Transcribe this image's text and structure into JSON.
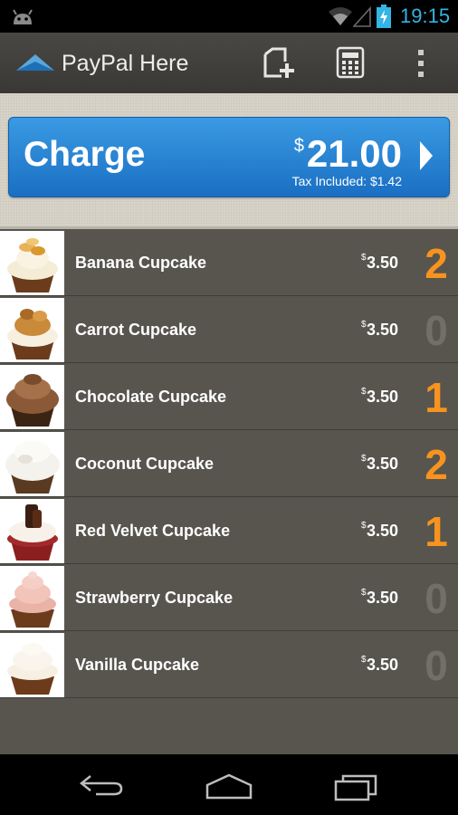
{
  "status_bar": {
    "time": "19:15"
  },
  "action_bar": {
    "title": "PayPal Here",
    "actions": [
      "new-item-icon",
      "calculator-icon",
      "overflow-menu-icon"
    ]
  },
  "charge": {
    "label": "Charge",
    "currency_symbol": "$",
    "amount": "21.00",
    "tax_text": "Tax Included: $1.42"
  },
  "items": [
    {
      "name": "Banana Cupcake",
      "currency_symbol": "$",
      "price": "3.50",
      "qty": "2"
    },
    {
      "name": "Carrot Cupcake",
      "currency_symbol": "$",
      "price": "3.50",
      "qty": "0"
    },
    {
      "name": "Chocolate Cupcake",
      "currency_symbol": "$",
      "price": "3.50",
      "qty": "1"
    },
    {
      "name": "Coconut Cupcake",
      "currency_symbol": "$",
      "price": "3.50",
      "qty": "2"
    },
    {
      "name": "Red Velvet Cupcake",
      "currency_symbol": "$",
      "price": "3.50",
      "qty": "1"
    },
    {
      "name": "Strawberry Cupcake",
      "currency_symbol": "$",
      "price": "3.50",
      "qty": "0"
    },
    {
      "name": "Vanilla Cupcake",
      "currency_symbol": "$",
      "price": "3.50",
      "qty": "0"
    }
  ],
  "colors": {
    "accent_blue": "#1a7fd4",
    "qty_active": "#f7931e",
    "qty_zero": "#726f66",
    "clock": "#33b5e5"
  }
}
